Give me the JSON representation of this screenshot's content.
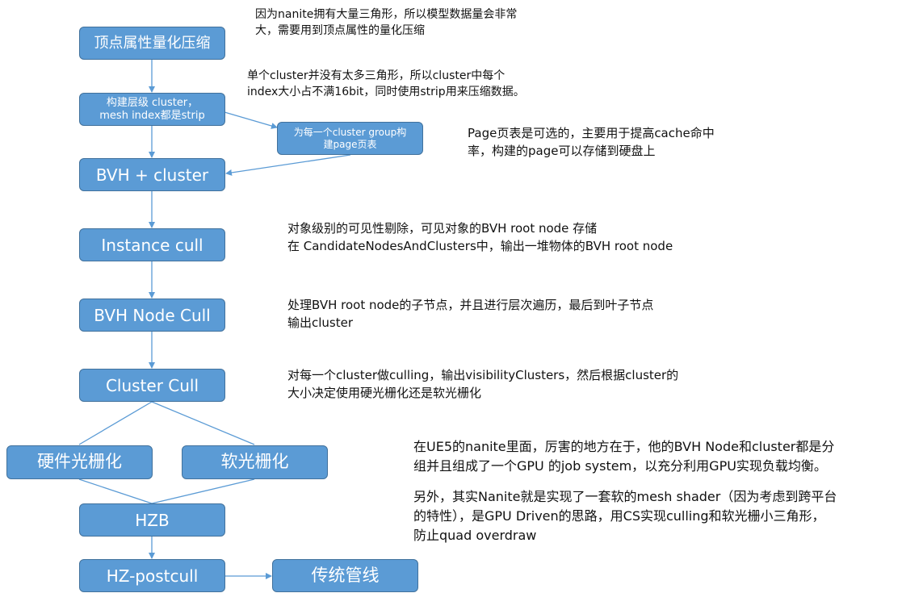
{
  "nodes": {
    "quantize": "顶点属性量化压缩",
    "build_cluster_line1": "构建层级 cluster，",
    "build_cluster_line2": "mesh index都是strip",
    "build_page_line1": "为每一个cluster group构",
    "build_page_line2": "建page页表",
    "bvh_cluster": "BVH + cluster",
    "instance_cull": "Instance cull",
    "bvh_node_cull": "BVH Node Cull",
    "cluster_cull": "Cluster Cull",
    "hw_raster": "硬件光栅化",
    "sw_raster": "软光栅化",
    "hzb": "HZB",
    "hz_postcull": "HZ-postcull",
    "traditional_pipeline": "传统管线"
  },
  "notes": {
    "quantize_note": [
      "因为nanite拥有大量三角形，所以模型数据量会非常",
      "大，需要用到顶点属性的量化压缩"
    ],
    "cluster_note": [
      "单个cluster并没有太多三角形，所以cluster中每个",
      "index大小占不满16bit，同时使用strip用来压缩数据。"
    ],
    "page_note": [
      "Page页表是可选的，主要用于提高cache命中",
      "率，构建的page可以存储到硬盘上"
    ],
    "instance_note": [
      "对象级别的可见性剔除，可见对象的BVH root node 存储",
      "在 CandidateNodesAndClusters中，输出一堆物体的BVH root node"
    ],
    "bvh_note": [
      "处理BVH root node的子节点，并且进行层次遍历，最后到叶子节点",
      "输出cluster"
    ],
    "cluster_cull_note": [
      "对每一个cluster做culling，输出visibilityClusters，然后根据cluster的",
      "大小决定使用硬光栅化还是软光栅化"
    ],
    "summary_note_1": [
      "在UE5的nanite里面，厉害的地方在于，他的BVH Node和cluster都是分",
      "组并且组成了一个GPU 的job system，以充分利用GPU实现负载均衡。"
    ],
    "summary_note_2": [
      "另外，其实Nanite就是实现了一套软的mesh shader（因为考虑到跨平台",
      "的特性），是GPU Driven的思路，用CS实现culling和软光栅小三角形，",
      "防止quad overdraw"
    ]
  },
  "colors": {
    "node_fill": "#5b9bd5",
    "node_border": "#41719c",
    "arrow": "#5b9bd5"
  }
}
